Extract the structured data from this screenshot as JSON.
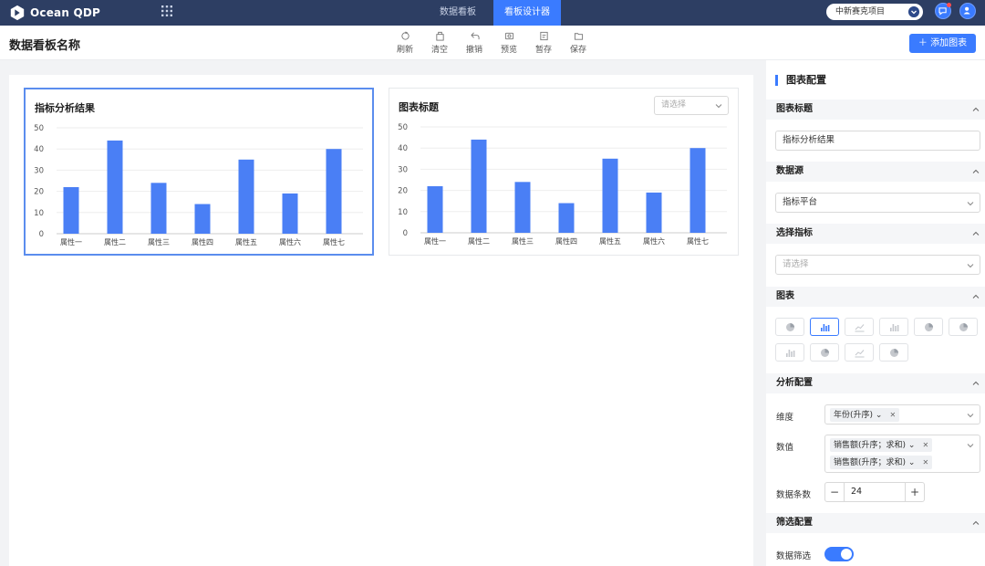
{
  "app": {
    "logo_text": "Ocean QDP"
  },
  "nav": {
    "tabs": [
      {
        "label": "数据看板"
      },
      {
        "label": "看板设计器"
      }
    ],
    "active": 1
  },
  "project": {
    "label": "中新赛克项目"
  },
  "toolbar": {
    "board_name": "数据看板名称",
    "tools": [
      {
        "label": "刷新",
        "icon": "refresh-icon"
      },
      {
        "label": "清空",
        "icon": "clear-icon"
      },
      {
        "label": "撤销",
        "icon": "undo-icon"
      },
      {
        "label": "预览",
        "icon": "preview-icon"
      },
      {
        "label": "暂存",
        "icon": "draft-icon"
      },
      {
        "label": "保存",
        "icon": "save-icon"
      }
    ],
    "add_chart_label": "添加图表"
  },
  "cards": [
    {
      "title": "指标分析结果",
      "selected": true,
      "select_placeholder": ""
    },
    {
      "title": "图表标题",
      "selected": false,
      "select_placeholder": "请选择"
    }
  ],
  "chart_data": [
    {
      "type": "bar",
      "categories": [
        "属性一",
        "属性二",
        "属性三",
        "属性四",
        "属性五",
        "属性六",
        "属性七"
      ],
      "values": [
        22,
        44,
        24,
        14,
        35,
        19,
        40
      ],
      "yticks": [
        0,
        10,
        20,
        30,
        40,
        50
      ],
      "ylim": [
        0,
        50
      ],
      "grid": true,
      "color": "#4a7ff5"
    },
    {
      "type": "bar",
      "categories": [
        "属性一",
        "属性二",
        "属性三",
        "属性四",
        "属性五",
        "属性六",
        "属性七"
      ],
      "values": [
        22,
        44,
        24,
        14,
        35,
        19,
        40
      ],
      "yticks": [
        0,
        10,
        20,
        30,
        40,
        50
      ],
      "ylim": [
        0,
        50
      ],
      "grid": true,
      "color": "#4a7ff5"
    }
  ],
  "panel": {
    "title": "图表配置",
    "sections": {
      "chart_title": "图表标题",
      "data_source": "数据源",
      "select_metric": "选择指标",
      "chart": "图表",
      "analysis": "分析配置",
      "filter": "筛选配置"
    },
    "chart_title_value": "指标分析结果",
    "data_source_value": "指标平台",
    "metric_placeholder": "请选择",
    "chart_types": [
      "pie-chart-icon",
      "bar-chart-icon",
      "line-chart-icon",
      "bar-chart-icon",
      "pie-chart-icon",
      "pie-chart-icon",
      "bar-chart-icon",
      "pie-chart-icon",
      "line-chart-icon",
      "pie-chart-icon"
    ],
    "active_chart_type": 1,
    "dimension_label": "维度",
    "dimension_tag": "年份(升序)",
    "value_label": "数值",
    "value_tags": [
      "销售额(升序；求和)",
      "销售额(升序；求和)"
    ],
    "row_count_label": "数据条数",
    "row_count": "24",
    "data_filter_label": "数据筛选",
    "data_filter_on": true
  }
}
